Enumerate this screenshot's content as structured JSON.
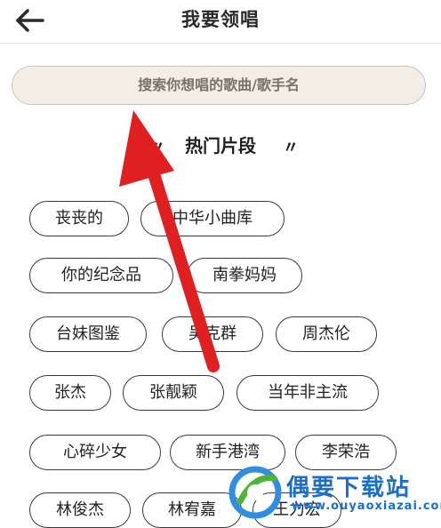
{
  "header": {
    "title": "我要领唱",
    "back_icon": "back-arrow-icon"
  },
  "search": {
    "placeholder": "搜索你想唱的歌曲/歌手名"
  },
  "section": {
    "title": "热门片段",
    "deco_left": "〃",
    "deco_right": "〃"
  },
  "tags": [
    "丧丧的",
    "中华小曲库",
    "你的纪念品",
    "南拳妈妈",
    "台妹图鉴",
    "吴克群",
    "周杰伦",
    "张杰",
    "张靓颖",
    "当年非主流",
    "心碎少女",
    "新手港湾",
    "李荣浩",
    "林俊杰",
    "林宥嘉",
    "王力宏"
  ],
  "annotation": {
    "arrow_color": "#e02020"
  },
  "watermark": {
    "text": "偶要下载站",
    "url": "www.ouyaoxiazai.com",
    "color": "#1a6fc9"
  }
}
